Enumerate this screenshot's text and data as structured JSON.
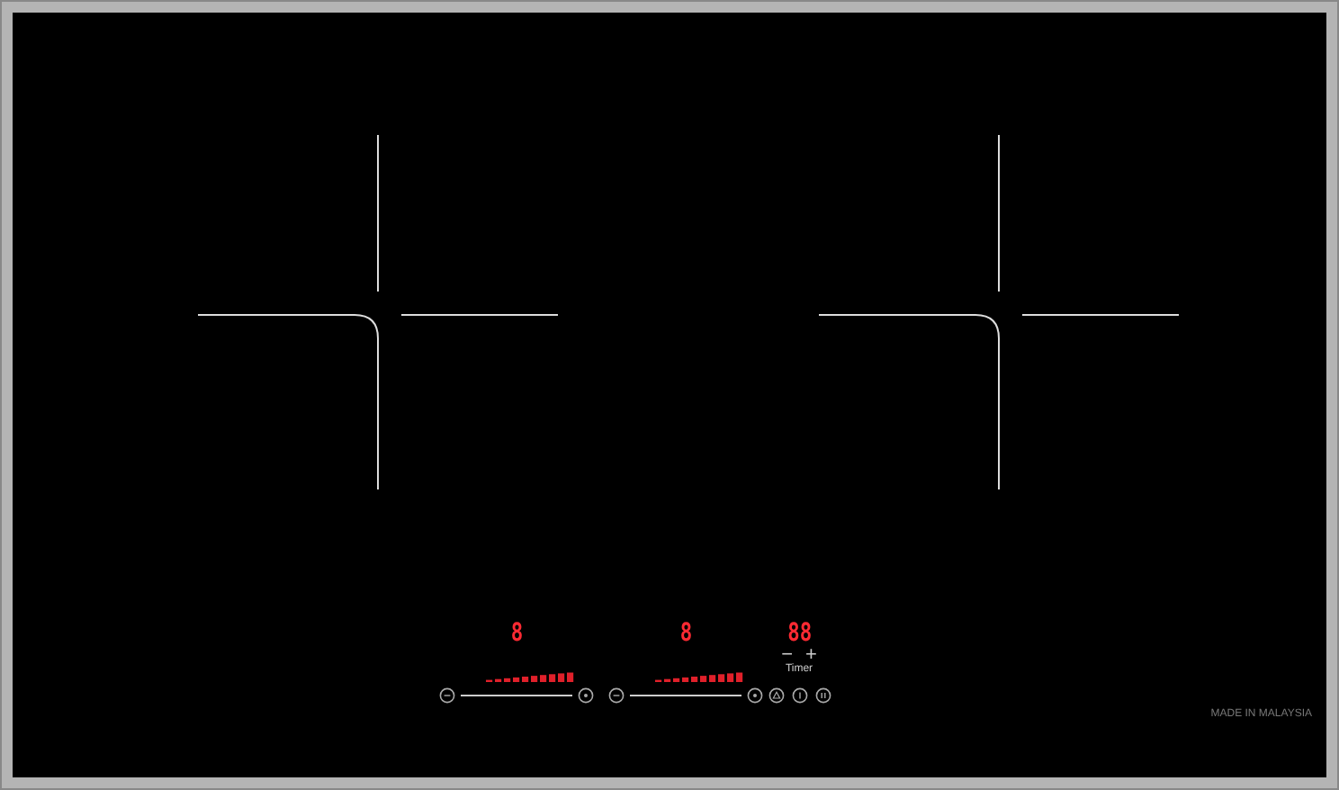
{
  "hob": {
    "zones": [
      {
        "display": "8"
      },
      {
        "display": "8"
      }
    ],
    "timer": {
      "display": "88",
      "minus": "−",
      "plus": "+",
      "label": "Timer"
    },
    "footer": "MADE IN MALAYSIA"
  }
}
